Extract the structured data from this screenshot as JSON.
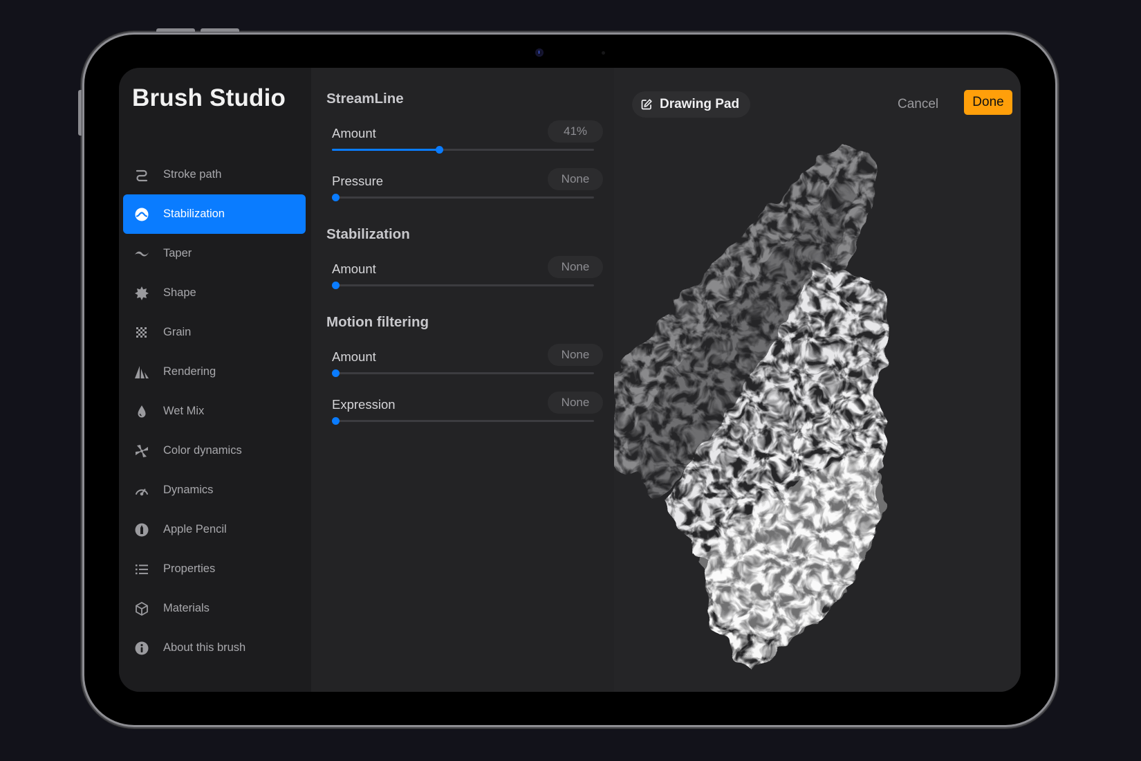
{
  "sidebar": {
    "title": "Brush Studio",
    "items": [
      {
        "label": "Stroke path",
        "icon": "stroke-path-icon",
        "active": false
      },
      {
        "label": "Stabilization",
        "icon": "stabilization-icon",
        "active": true
      },
      {
        "label": "Taper",
        "icon": "taper-icon",
        "active": false
      },
      {
        "label": "Shape",
        "icon": "shape-icon",
        "active": false
      },
      {
        "label": "Grain",
        "icon": "grain-icon",
        "active": false
      },
      {
        "label": "Rendering",
        "icon": "rendering-icon",
        "active": false
      },
      {
        "label": "Wet Mix",
        "icon": "wet-mix-icon",
        "active": false
      },
      {
        "label": "Color dynamics",
        "icon": "color-dynamics-icon",
        "active": false
      },
      {
        "label": "Dynamics",
        "icon": "dynamics-icon",
        "active": false
      },
      {
        "label": "Apple Pencil",
        "icon": "apple-pencil-icon",
        "active": false
      },
      {
        "label": "Properties",
        "icon": "properties-icon",
        "active": false
      },
      {
        "label": "Materials",
        "icon": "materials-icon",
        "active": false
      },
      {
        "label": "About this brush",
        "icon": "info-icon",
        "active": false
      }
    ]
  },
  "settings": {
    "streamline": {
      "title": "StreamLine",
      "amount": {
        "label": "Amount",
        "value": "41%",
        "fraction": 0.41
      },
      "pressure": {
        "label": "Pressure",
        "value": "None",
        "fraction": 0
      }
    },
    "stabilization": {
      "title": "Stabilization",
      "amount": {
        "label": "Amount",
        "value": "None",
        "fraction": 0
      }
    },
    "motion_filtering": {
      "title": "Motion filtering",
      "amount": {
        "label": "Amount",
        "value": "None",
        "fraction": 0
      },
      "expression": {
        "label": "Expression",
        "value": "None",
        "fraction": 0
      }
    }
  },
  "drawing_pad": {
    "title": "Drawing Pad",
    "icon": "edit-icon",
    "cancel_label": "Cancel",
    "done_label": "Done"
  },
  "colors": {
    "accent_blue": "#0a7cff",
    "done_orange": "#ff9f0a",
    "sidebar_bg": "#1c1c1e",
    "settings_bg": "#232325",
    "pad_bg": "#252527"
  }
}
